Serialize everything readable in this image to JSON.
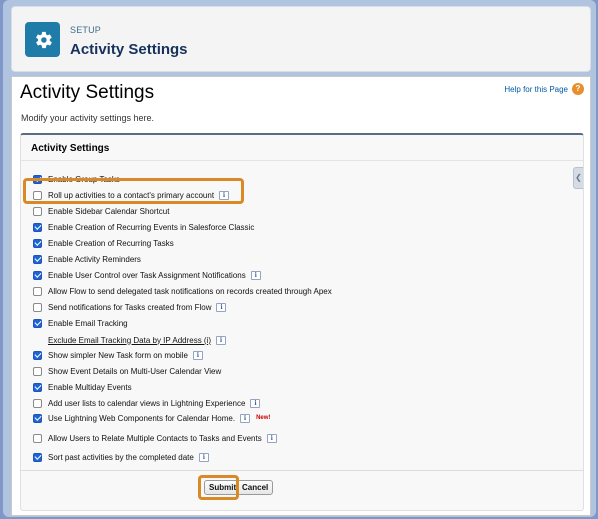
{
  "header": {
    "kicker": "SETUP",
    "title": "Activity Settings",
    "icon": "gear-icon"
  },
  "page": {
    "title": "Activity Settings",
    "help_link": "Help for this Page",
    "help_icon": "?",
    "subtitle": "Modify your activity settings here."
  },
  "section": {
    "title": "Activity Settings",
    "scroll_tab_glyph": "❮"
  },
  "settings": [
    {
      "label": "Enable Group Tasks",
      "checked": true,
      "info": false
    },
    {
      "label": "Roll up activities to a contact's primary account",
      "checked": false,
      "info": true
    },
    {
      "label": "Enable Sidebar Calendar Shortcut",
      "checked": false,
      "info": false
    },
    {
      "label": "Enable Creation of Recurring Events in Salesforce Classic",
      "checked": true,
      "info": false
    },
    {
      "label": "Enable Creation of Recurring Tasks",
      "checked": true,
      "info": false
    },
    {
      "label": "Enable Activity Reminders",
      "checked": true,
      "info": false
    },
    {
      "label": "Enable User Control over Task Assignment Notifications",
      "checked": true,
      "info": true
    },
    {
      "label": "Allow Flow to send delegated task notifications on records created through Apex",
      "checked": false,
      "info": false
    },
    {
      "label": "Send notifications for Tasks created from Flow",
      "checked": false,
      "info": true
    },
    {
      "label": "Enable Email Tracking",
      "checked": true,
      "info": false
    },
    {
      "label": "Exclude Email Tracking Data by IP Address (i)",
      "checked": null,
      "info": true,
      "link": true
    },
    {
      "label": "Show simpler New Task form on mobile",
      "checked": true,
      "info": true
    },
    {
      "label": "Show Event Details on Multi-User Calendar View",
      "checked": false,
      "info": false
    },
    {
      "label": "Enable Multiday Events",
      "checked": true,
      "info": false
    },
    {
      "label": "Add user lists to calendar views in Lightning Experience",
      "checked": false,
      "info": true
    },
    {
      "label": "Use Lightning Web Components for Calendar Home.",
      "checked": true,
      "info": true,
      "badge": "New!"
    },
    {
      "label": "Allow Users to Relate Multiple Contacts to Tasks and Events",
      "checked": false,
      "info": true
    },
    {
      "label": "Sort past activities by the completed date",
      "checked": true,
      "info": true
    }
  ],
  "buttons": {
    "submit": "Submit",
    "cancel": "Cancel"
  },
  "info_glyph": "i",
  "colors": {
    "highlight": "#d98925",
    "checkbox": "#1f64d6",
    "header_icon_bg": "#1f7ba8"
  }
}
